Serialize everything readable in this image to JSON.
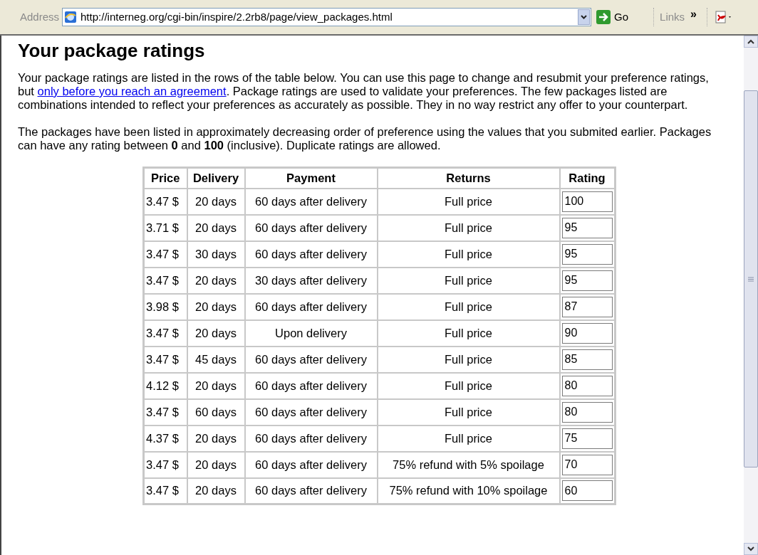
{
  "toolbar": {
    "address_label": "Address",
    "url": "http://interneg.org/cgi-bin/inspire/2.2rb8/page/view_packages.html",
    "go": "Go",
    "links": "Links",
    "chevron": "»"
  },
  "heading": "Your package ratings",
  "paragraphs": [
    {
      "before": "Your package ratings are listed in the rows of the table below. You can use this page to change and resubmit your preference ratings, but ",
      "link": "only before you reach an agreement",
      "after": ". Package ratings are used to validate your preferences. The few packages listed are combinations intended to reflect your preferences as accurately as possible. They in no way restrict any offer to your counterpart."
    },
    {
      "before": "The packages have been listed in approximately decreasing order of preference using the values that you submited earlier. Packages can have any rating between **0** and **100** (inclusive). Duplicate ratings are allowed."
    }
  ],
  "table": {
    "columns": [
      "Price",
      "Delivery",
      "Payment",
      "Returns",
      "Rating"
    ],
    "rows": [
      {
        "price": "3.47 $",
        "delivery": "20 days",
        "payment": "60 days after delivery",
        "returns": "Full price",
        "rating": "100"
      },
      {
        "price": "3.71 $",
        "delivery": "20 days",
        "payment": "60 days after delivery",
        "returns": "Full price",
        "rating": "95"
      },
      {
        "price": "3.47 $",
        "delivery": "30 days",
        "payment": "60 days after delivery",
        "returns": "Full price",
        "rating": "95"
      },
      {
        "price": "3.47 $",
        "delivery": "20 days",
        "payment": "30 days after delivery",
        "returns": "Full price",
        "rating": "95"
      },
      {
        "price": "3.98 $",
        "delivery": "20 days",
        "payment": "60 days after delivery",
        "returns": "Full price",
        "rating": "87"
      },
      {
        "price": "3.47 $",
        "delivery": "20 days",
        "payment": "Upon delivery",
        "returns": "Full price",
        "rating": "90"
      },
      {
        "price": "3.47 $",
        "delivery": "45 days",
        "payment": "60 days after delivery",
        "returns": "Full price",
        "rating": "85"
      },
      {
        "price": "4.12 $",
        "delivery": "20 days",
        "payment": "60 days after delivery",
        "returns": "Full price",
        "rating": "80"
      },
      {
        "price": "3.47 $",
        "delivery": "60 days",
        "payment": "60 days after delivery",
        "returns": "Full price",
        "rating": "80"
      },
      {
        "price": "4.37 $",
        "delivery": "20 days",
        "payment": "60 days after delivery",
        "returns": "Full price",
        "rating": "75"
      },
      {
        "price": "3.47 $",
        "delivery": "20 days",
        "payment": "60 days after delivery",
        "returns": "75% refund with 5% spoilage",
        "rating": "70"
      },
      {
        "price": "3.47 $",
        "delivery": "20 days",
        "payment": "60 days after delivery",
        "returns": "75% refund with 10% spoilage",
        "rating": "60"
      }
    ]
  }
}
